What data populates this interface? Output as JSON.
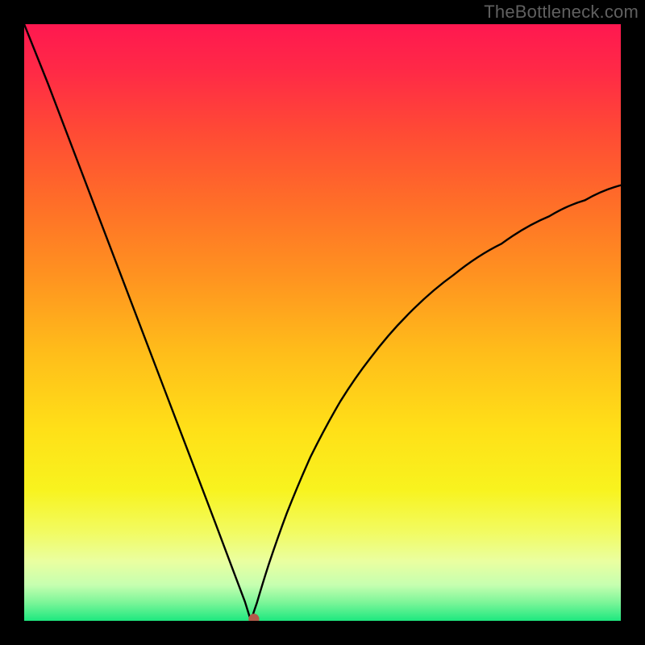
{
  "watermark": "TheBottleneck.com",
  "gradient_stops": [
    {
      "offset": 0.0,
      "color": "#ff1850"
    },
    {
      "offset": 0.08,
      "color": "#ff2a46"
    },
    {
      "offset": 0.18,
      "color": "#ff4a35"
    },
    {
      "offset": 0.3,
      "color": "#ff6e28"
    },
    {
      "offset": 0.42,
      "color": "#ff9220"
    },
    {
      "offset": 0.55,
      "color": "#ffbd1a"
    },
    {
      "offset": 0.68,
      "color": "#ffe018"
    },
    {
      "offset": 0.78,
      "color": "#f8f31e"
    },
    {
      "offset": 0.85,
      "color": "#f2fb60"
    },
    {
      "offset": 0.9,
      "color": "#eaffa0"
    },
    {
      "offset": 0.94,
      "color": "#c6ffb0"
    },
    {
      "offset": 0.97,
      "color": "#7af598"
    },
    {
      "offset": 1.0,
      "color": "#1ee87f"
    }
  ],
  "chart_data": {
    "type": "line",
    "title": "",
    "xlabel": "",
    "ylabel": "",
    "xlim": [
      0,
      100
    ],
    "ylim": [
      0,
      100
    ],
    "series": [
      {
        "name": "bottleneck-curve",
        "description": "V-shaped curve: steep linear descent from top-left to a cusp/minimum near x≈38, then a concave-down rise toward the right edge reaching ~y≈73 at x=100.",
        "x": [
          0,
          4,
          8,
          12,
          16,
          20,
          24,
          28,
          32,
          35,
          37,
          38,
          39,
          41,
          44,
          48,
          53,
          58,
          64,
          72,
          80,
          88,
          94,
          100
        ],
        "y": [
          100,
          90,
          79.5,
          69,
          58.5,
          48,
          37.5,
          27,
          16.5,
          8.5,
          3.2,
          0.0,
          3.0,
          9.5,
          18.0,
          27.5,
          36.8,
          44.0,
          51.0,
          58.0,
          63.2,
          67.8,
          70.5,
          73.0
        ]
      }
    ],
    "marker": {
      "x": 38.5,
      "y": 0.3,
      "color": "#b35a4a",
      "radius_frac": 0.009
    },
    "grid": false,
    "legend": false
  }
}
